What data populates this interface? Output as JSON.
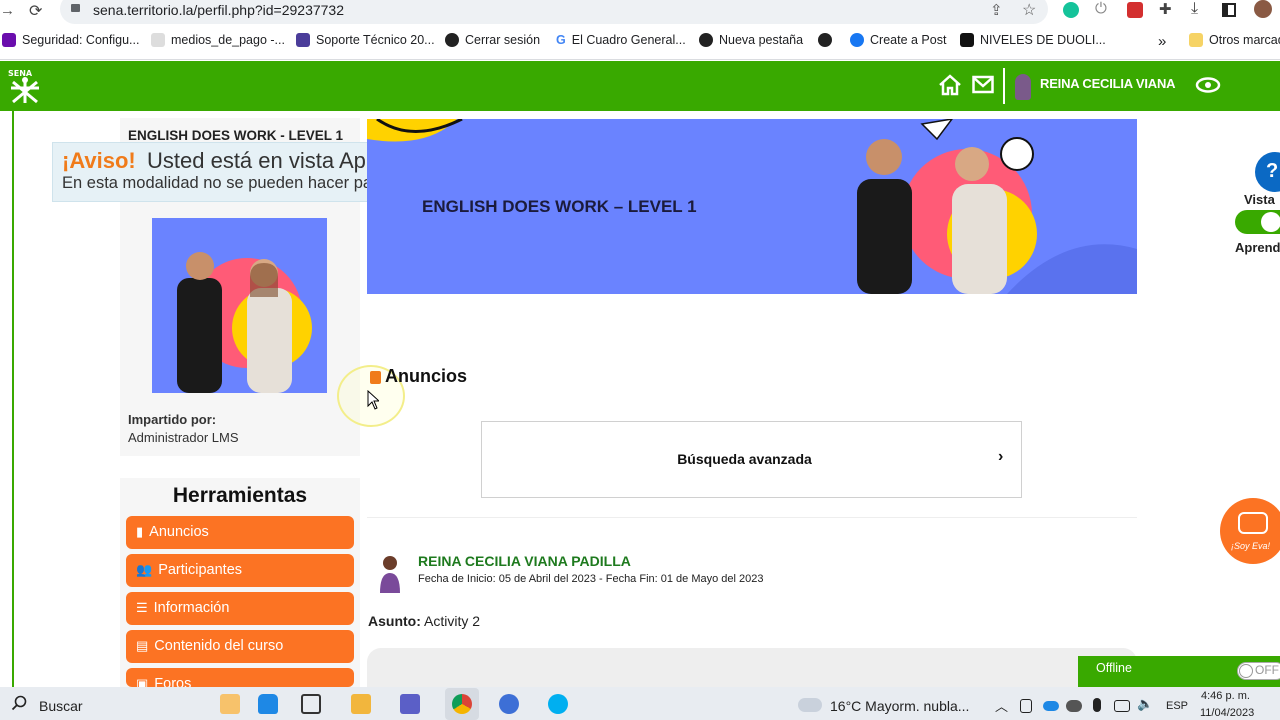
{
  "browser": {
    "url": "sena.territorio.la/perfil.php?id=29237732",
    "bookmarks": [
      {
        "label": "Seguridad: Configu...",
        "color": "#6a0dad"
      },
      {
        "label": "medios_de_pago -...",
        "color": "#cccccc"
      },
      {
        "label": "Soporte Técnico 20...",
        "color": "#4b3d9a"
      },
      {
        "label": "Cerrar sesión",
        "color": "#222222"
      },
      {
        "label": "El Cuadro General...",
        "color": "#4285f4"
      },
      {
        "label": "Nueva pestaña",
        "color": "#222222"
      },
      {
        "label": "",
        "color": "#222222"
      },
      {
        "label": "Create a Post",
        "color": "#1877f2"
      },
      {
        "label": "NIVELES DE DUOLI...",
        "color": "#111111"
      }
    ],
    "bookmarks_more": "»",
    "other_bookmarks": "Otros marcad"
  },
  "header": {
    "user_name": "REINA CECILIA VIANA",
    "brand_color": "#39a900"
  },
  "aviso": {
    "strong": "¡Aviso!",
    "main": "Usted está en vista Aprendiz.",
    "sub": "En esta modalidad no se pueden hacer participaciones."
  },
  "course": {
    "title": "ENGLISH DOES WORK - LEVEL 1",
    "banner_title": "ENGLISH DOES WORK – LEVEL 1",
    "impartido_label": "Impartido por:",
    "impartido_value": "Administrador LMS"
  },
  "tools": {
    "title": "Herramientas",
    "items": [
      {
        "label": "Anuncios",
        "icon": "▮"
      },
      {
        "label": "Participantes",
        "icon": "👥"
      },
      {
        "label": "Información",
        "icon": "☰"
      },
      {
        "label": "Contenido del curso",
        "icon": "▤"
      },
      {
        "label": "Foros",
        "icon": "▣"
      }
    ]
  },
  "anuncios": {
    "heading": "Anuncios",
    "search_label": "Búsqueda avanzada",
    "chevron": "›"
  },
  "post": {
    "author": "REINA CECILIA VIANA PADILLA",
    "dates": "Fecha de Inicio: 05 de Abril del 2023 - Fecha Fin: 01 de Mayo del 2023",
    "asunto_label": "Asunto:",
    "asunto_value": "Activity 2"
  },
  "right_panel": {
    "vista_label": "Vista",
    "aprendiz_label": "Aprend",
    "eva_label": "¡Soy Eva!"
  },
  "offline": {
    "label": "Offline",
    "toggle": "OFF"
  },
  "taskbar": {
    "search": "Buscar",
    "weather": "16°C  Mayorm. nubla...",
    "lang": "ESP",
    "time": "4:46 p. m.",
    "date": "11/04/2023"
  }
}
